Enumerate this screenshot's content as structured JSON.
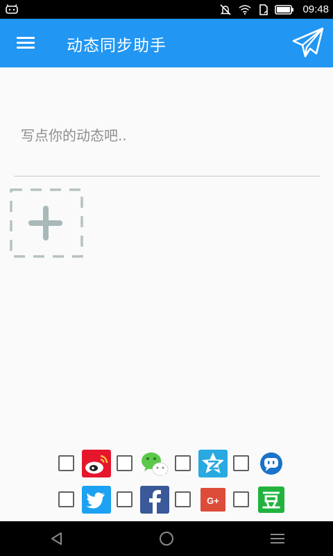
{
  "status_bar": {
    "time": "09:48",
    "icons": [
      "android-notification-icon",
      "mute-icon",
      "wifi-icon",
      "sim-icon",
      "battery-icon"
    ]
  },
  "app_bar": {
    "title": "动态同步助手",
    "menu_icon": "hamburger-menu-icon",
    "send_icon": "paper-plane-icon",
    "background": "#2196f3"
  },
  "compose": {
    "placeholder": "写点你的动态吧..",
    "value": ""
  },
  "add_photo": {
    "icon": "plus-icon"
  },
  "share_targets": [
    [
      {
        "service": "weibo",
        "icon": "weibo-icon",
        "checked": false
      },
      {
        "service": "wechat",
        "icon": "wechat-icon",
        "checked": false
      },
      {
        "service": "qzone",
        "icon": "qzone-icon",
        "checked": false
      },
      {
        "service": "talk",
        "icon": "chat-bubble-icon",
        "checked": false
      }
    ],
    [
      {
        "service": "twitter",
        "icon": "twitter-icon",
        "checked": false
      },
      {
        "service": "facebook",
        "icon": "facebook-icon",
        "checked": false
      },
      {
        "service": "googleplus",
        "icon": "google-plus-icon",
        "checked": false,
        "label": "G+"
      },
      {
        "service": "douban",
        "icon": "douban-icon",
        "checked": false,
        "label": "豆"
      }
    ]
  ],
  "nav_bar": {
    "icons": [
      "back-icon",
      "home-icon",
      "menu-icon"
    ]
  }
}
